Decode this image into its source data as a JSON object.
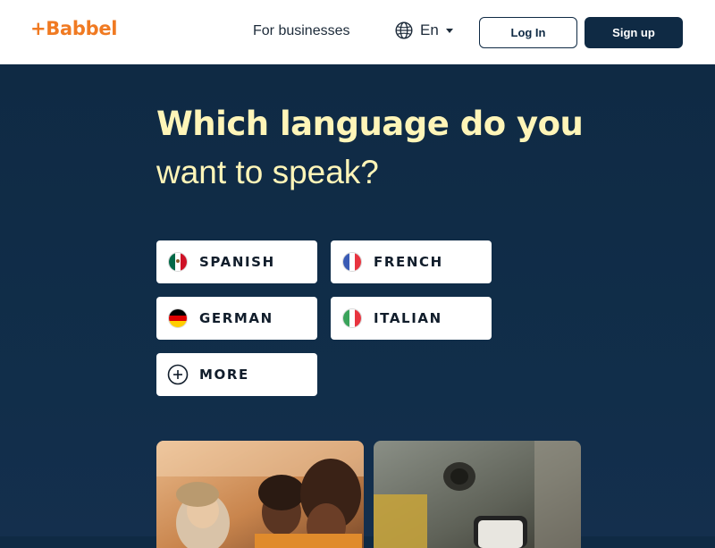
{
  "header": {
    "logo_text": "+Babbel",
    "for_businesses": "For businesses",
    "language_code": "En",
    "login_label": "Log In",
    "signup_label": "Sign up"
  },
  "hero": {
    "title_line1": "Which language do you",
    "title_line2": "want to speak?"
  },
  "languages": [
    {
      "label": "SPANISH",
      "flag": "mexico-flag-icon"
    },
    {
      "label": "FRENCH",
      "flag": "france-flag-icon"
    },
    {
      "label": "GERMAN",
      "flag": "germany-flag-icon"
    },
    {
      "label": "ITALIAN",
      "flag": "italy-flag-icon"
    },
    {
      "label": "MORE",
      "flag": "plus-circle-icon"
    }
  ],
  "colors": {
    "brand_orange": "#f07a22",
    "navy": "#0f2a44",
    "title_yellow": "#fff5b8"
  }
}
